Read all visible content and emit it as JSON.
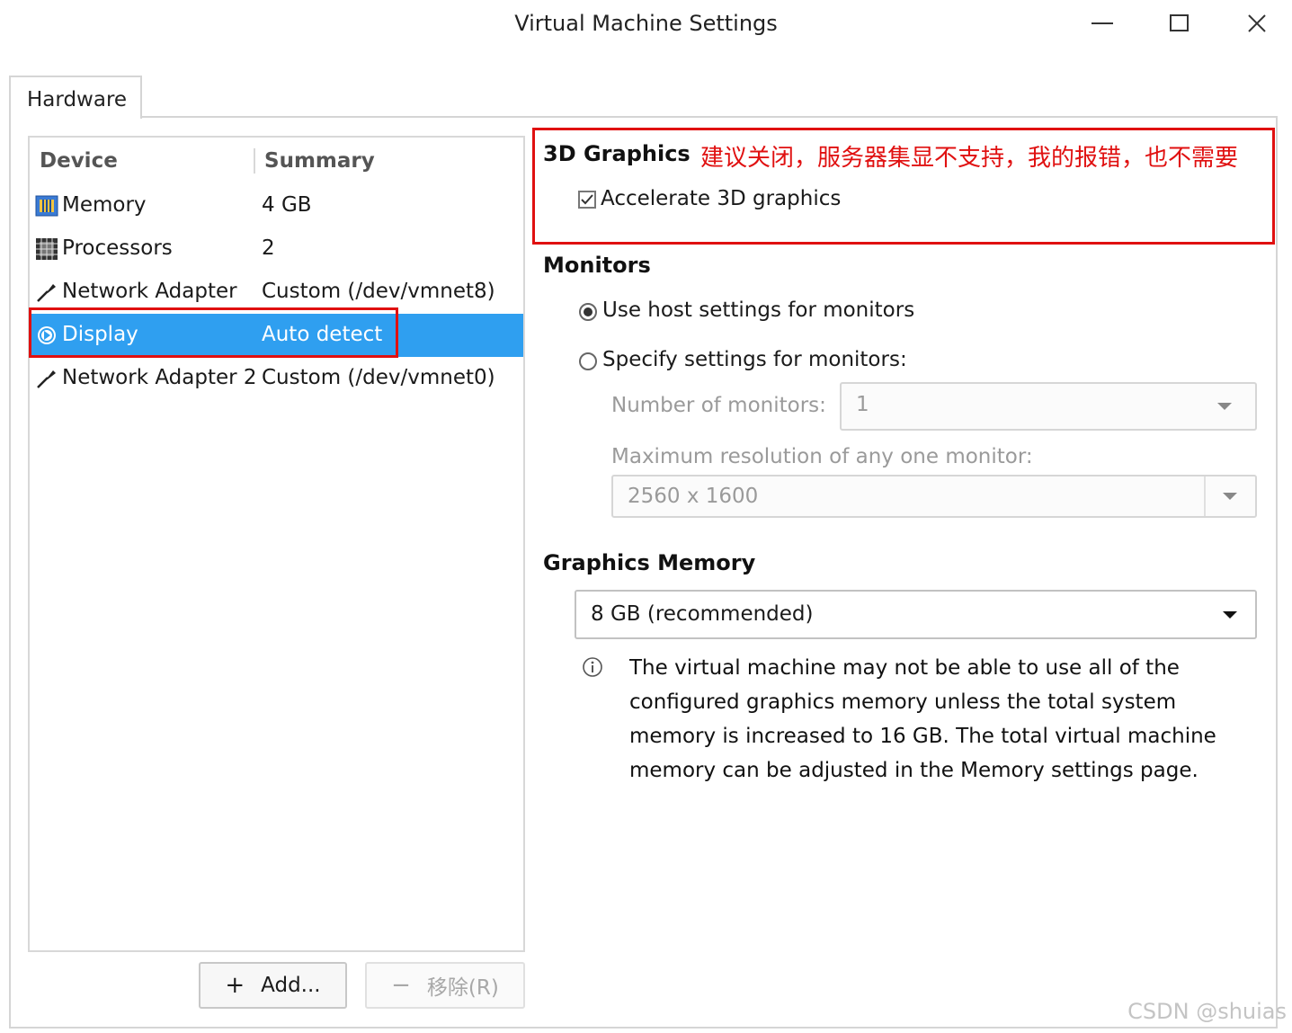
{
  "window": {
    "title": "Virtual Machine Settings"
  },
  "tabs": [
    {
      "label": "Hardware"
    }
  ],
  "device_list": {
    "columns": [
      "Device",
      "Summary"
    ],
    "rows": [
      {
        "name": "Memory",
        "summary": "4 GB",
        "icon": "memory-icon"
      },
      {
        "name": "Processors",
        "summary": "2",
        "icon": "processor-icon"
      },
      {
        "name": "Network Adapter",
        "summary": "Custom (/dev/vmnet8)",
        "icon": "network-icon"
      },
      {
        "name": "Display",
        "summary": "Auto detect",
        "icon": "display-icon",
        "selected": true
      },
      {
        "name": "Network Adapter 2",
        "summary": "Custom (/dev/vmnet0)",
        "icon": "network-icon"
      }
    ]
  },
  "buttons": {
    "add": "Add...",
    "remove": "移除(R)"
  },
  "graphics3d": {
    "title": "3D Graphics",
    "accelerate_label": "Accelerate 3D graphics",
    "accelerate_checked": true,
    "annotation": "建议关闭，服务器集显不支持，我的报错，也不需要"
  },
  "monitors": {
    "title": "Monitors",
    "use_host_label": "Use host settings for monitors",
    "use_host_selected": true,
    "specify_label": "Specify settings for monitors:",
    "number_label": "Number of monitors:",
    "number_value": "1",
    "max_res_label": "Maximum resolution of any one monitor:",
    "max_res_value": "2560 x 1600"
  },
  "graphics_memory": {
    "title": "Graphics Memory",
    "value": "8 GB (recommended)",
    "info": "The virtual machine may not be able to use all of the configured graphics memory unless the total system memory is increased to 16 GB. The total virtual machine memory can be adjusted in the Memory settings page."
  },
  "watermark": "CSDN @shuias",
  "colors": {
    "selection": "#2f9ff0",
    "annotation_red": "#e01010"
  }
}
